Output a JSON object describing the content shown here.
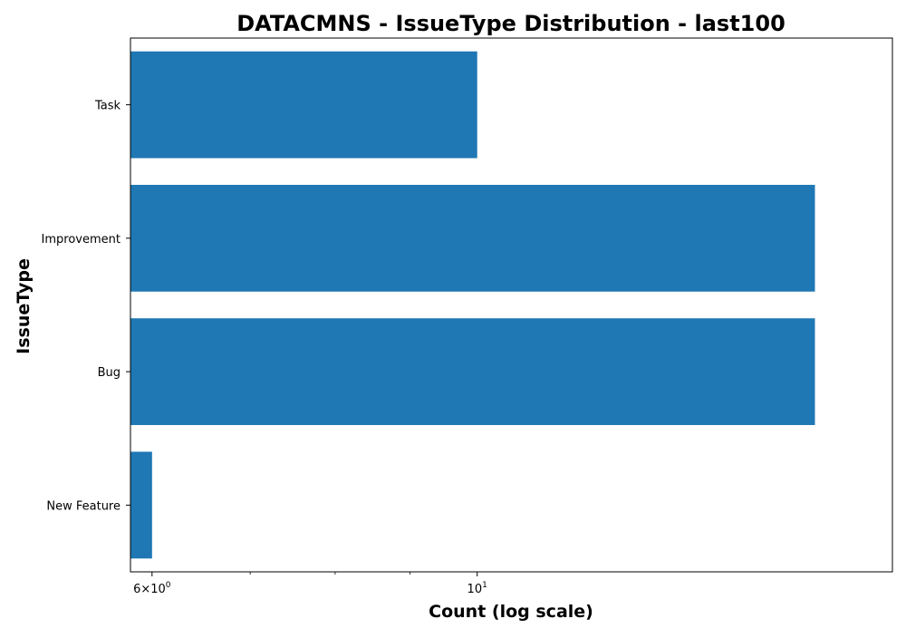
{
  "chart_data": {
    "type": "bar",
    "orientation": "horizontal",
    "title": "DATACMNS - IssueType Distribution - last100",
    "xlabel": "Count (log scale)",
    "ylabel": "IssueType",
    "x_scale": "log",
    "xlim": [
      5.8,
      19.2
    ],
    "categories": [
      "Task",
      "Improvement",
      "Bug",
      "New Feature"
    ],
    "values": [
      10,
      17,
      17,
      6
    ],
    "bar_color": "#1f77b4",
    "grid": false,
    "major_ticks": [
      {
        "value": 6,
        "base": "6×10",
        "exp": "0"
      },
      {
        "value": 10,
        "base": "10",
        "exp": "1"
      }
    ],
    "minor_ticks": [
      7,
      8,
      9
    ]
  }
}
